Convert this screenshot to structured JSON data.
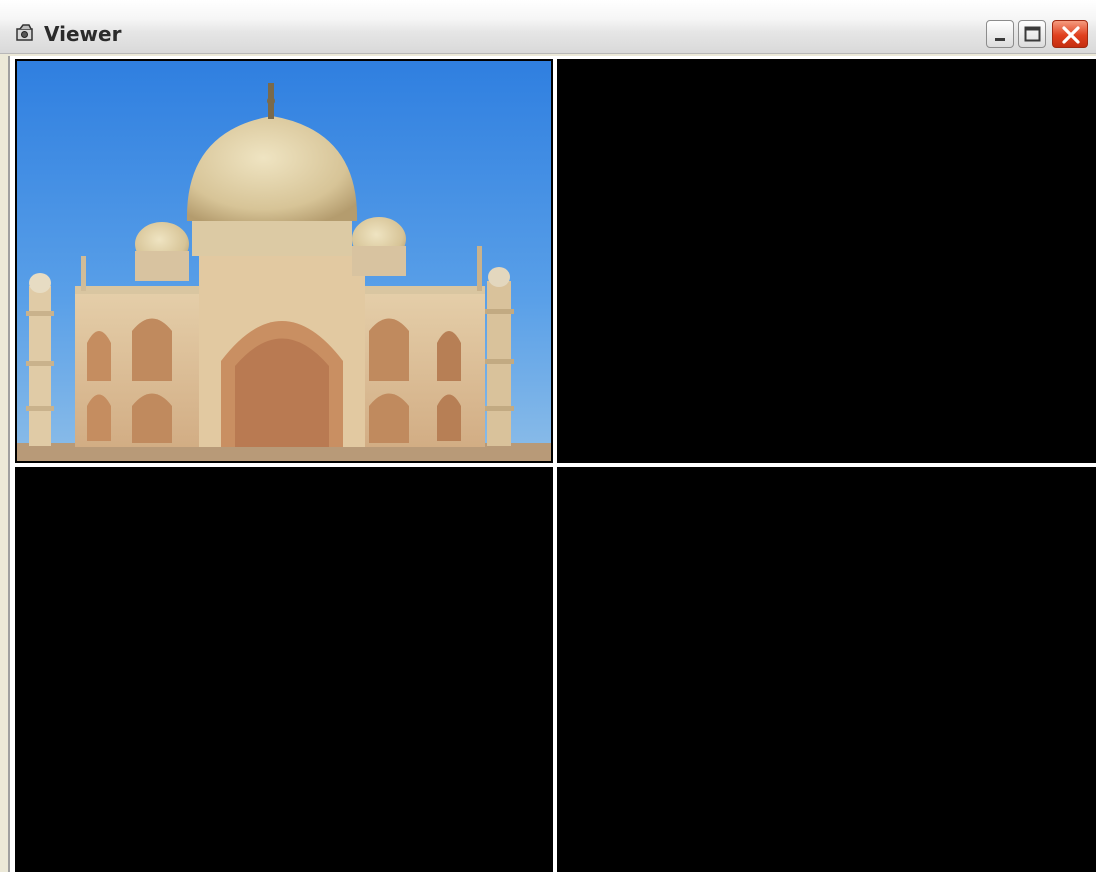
{
  "window": {
    "title": "Viewer",
    "app_icon": "camera-icon",
    "controls": {
      "minimize_icon": "minimize-icon",
      "maximize_icon": "maximize-icon",
      "close_icon": "close-icon"
    }
  },
  "viewer": {
    "layout": "2x2 grid",
    "panes": [
      {
        "index": 1,
        "content": "image"
      },
      {
        "index": 2,
        "content": "empty"
      },
      {
        "index": 3,
        "content": "empty"
      },
      {
        "index": 4,
        "content": "empty"
      }
    ]
  }
}
